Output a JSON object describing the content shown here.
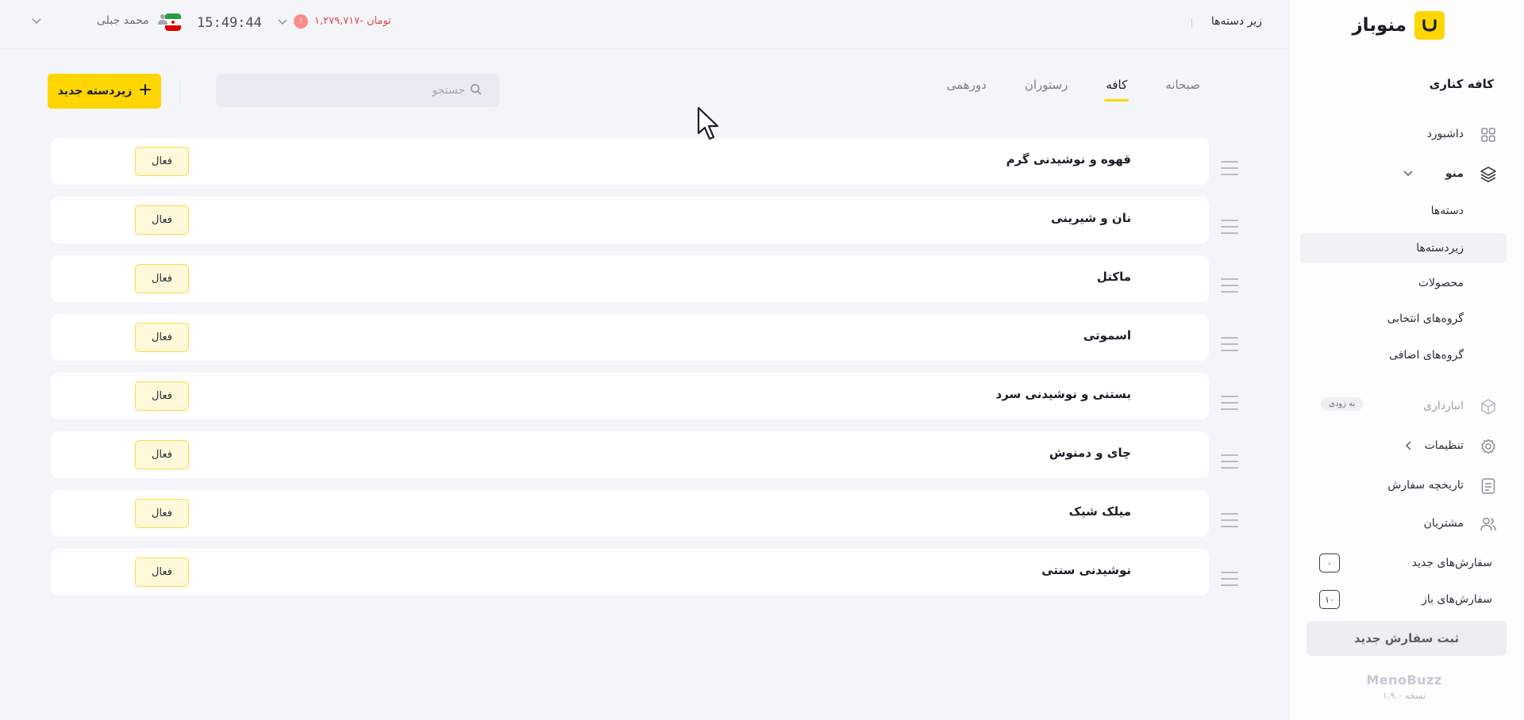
{
  "brand": {
    "name": "منوباز"
  },
  "sidebar": {
    "cafe_name": "کافه کناری",
    "items": [
      {
        "label": "داشبورد",
        "icon": "grid-icon"
      },
      {
        "label": "منو",
        "icon": "layers-icon"
      },
      {
        "label": "انبارداری",
        "icon": "box-icon",
        "badge": "به زودی"
      },
      {
        "label": "تنظیمات",
        "icon": "gear-icon"
      },
      {
        "label": "تاریخچه سفارش",
        "icon": "document-icon"
      },
      {
        "label": "مشتریان",
        "icon": "users-icon"
      }
    ],
    "menu_sub": [
      {
        "label": "دسته‌ها"
      },
      {
        "label": "زیردسته‌ها",
        "active": true
      },
      {
        "label": "محصولات"
      },
      {
        "label": "گروه‌های انتخابی"
      },
      {
        "label": "گروه‌های اضافی"
      }
    ],
    "new_orders": {
      "label": "سفارش‌های جدید",
      "count": "۰"
    },
    "open_orders": {
      "label": "سفارش‌های باز",
      "count": "۱۰"
    },
    "new_order_button": "ثبت سفارش جدید",
    "footer": {
      "brand": "MenoBuzz",
      "version": "نسخه ۱.۹.۰"
    }
  },
  "topbar": {
    "title": "زیر دسته‌ها",
    "user_name": "محمد جبلی",
    "time": "15:49:44",
    "balance": "-۱,۲۷۹,۷۱۷",
    "currency": "تومان",
    "alert": "!"
  },
  "tabs": [
    {
      "label": "صبحانه"
    },
    {
      "label": "کافه",
      "active": true
    },
    {
      "label": "رستوران"
    },
    {
      "label": "دورهمی"
    }
  ],
  "search": {
    "placeholder": "جستجو"
  },
  "add_button": "زیردسته جدید",
  "rows": [
    {
      "name": "قهوه و نوشیدنی گرم",
      "status": "فعال"
    },
    {
      "name": "نان و شیرینی",
      "status": "فعال"
    },
    {
      "name": "ماکتل",
      "status": "فعال"
    },
    {
      "name": "اسموتی",
      "status": "فعال"
    },
    {
      "name": "بستنی و نوشیدنی سرد",
      "status": "فعال"
    },
    {
      "name": "چای و دمنوش",
      "status": "فعال"
    },
    {
      "name": "میلک شیک",
      "status": "فعال"
    },
    {
      "name": "نوشیدنی سنتی",
      "status": "فعال"
    }
  ],
  "colors": {
    "accent": "#ffd600",
    "danger": "#e0454a",
    "status_bg": "#fff8d9"
  }
}
